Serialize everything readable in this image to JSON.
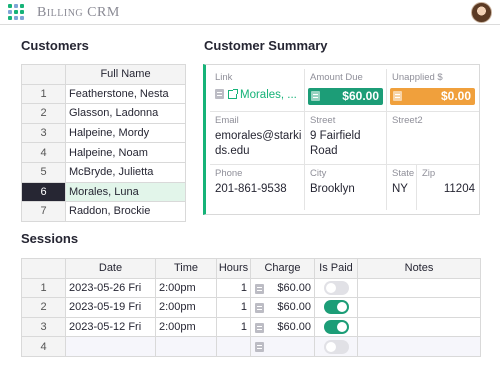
{
  "app": {
    "title": "Billing CRM"
  },
  "colors": {
    "accent": "#16b378",
    "amount_due": "#1c9d77",
    "unapplied": "#f0a03c",
    "selected_row": "#262633"
  },
  "customers": {
    "title": "Customers",
    "column_header": "Full Name",
    "rows": [
      {
        "num": "1",
        "name": "Featherstone, Nesta"
      },
      {
        "num": "2",
        "name": "Glasson, Ladonna"
      },
      {
        "num": "3",
        "name": "Halpeine, Mordy"
      },
      {
        "num": "4",
        "name": "Halpeine, Noam"
      },
      {
        "num": "5",
        "name": "McBryde, Julietta"
      },
      {
        "num": "6",
        "name": "Morales, Luna",
        "selected": true
      },
      {
        "num": "7",
        "name": "Raddon, Brockie"
      }
    ]
  },
  "summary": {
    "title": "Customer Summary",
    "link_label": "Link",
    "link_value": "Morales, ...",
    "amount_due_label": "Amount Due",
    "amount_due_value": "$60.00",
    "unapplied_label": "Unapplied $",
    "unapplied_value": "$0.00",
    "email_label": "Email",
    "email_value": "emorales@starkids.edu",
    "street_label": "Street",
    "street_value": "9 Fairfield Road",
    "street2_label": "Street2",
    "street2_value": "",
    "phone_label": "Phone",
    "phone_value": "201-861-9538",
    "city_label": "City",
    "city_value": "Brooklyn",
    "state_label": "State",
    "state_value": "NY",
    "zip_label": "Zip",
    "zip_value": "11204"
  },
  "sessions": {
    "title": "Sessions",
    "headers": {
      "date": "Date",
      "time": "Time",
      "hours": "Hours",
      "charge": "Charge",
      "is_paid": "Is Paid",
      "notes": "Notes"
    },
    "rows": [
      {
        "num": "1",
        "date": "2023-05-26 Fri",
        "time": "2:00pm",
        "hours": "1",
        "charge": "$60.00",
        "is_paid": false,
        "notes": ""
      },
      {
        "num": "2",
        "date": "2023-05-19 Fri",
        "time": "2:00pm",
        "hours": "1",
        "charge": "$60.00",
        "is_paid": true,
        "notes": ""
      },
      {
        "num": "3",
        "date": "2023-05-12 Fri",
        "time": "2:00pm",
        "hours": "1",
        "charge": "$60.00",
        "is_paid": true,
        "notes": ""
      },
      {
        "num": "4",
        "date": "",
        "time": "",
        "hours": "",
        "charge": "",
        "is_paid": false,
        "notes": "",
        "new_row": true
      }
    ]
  }
}
